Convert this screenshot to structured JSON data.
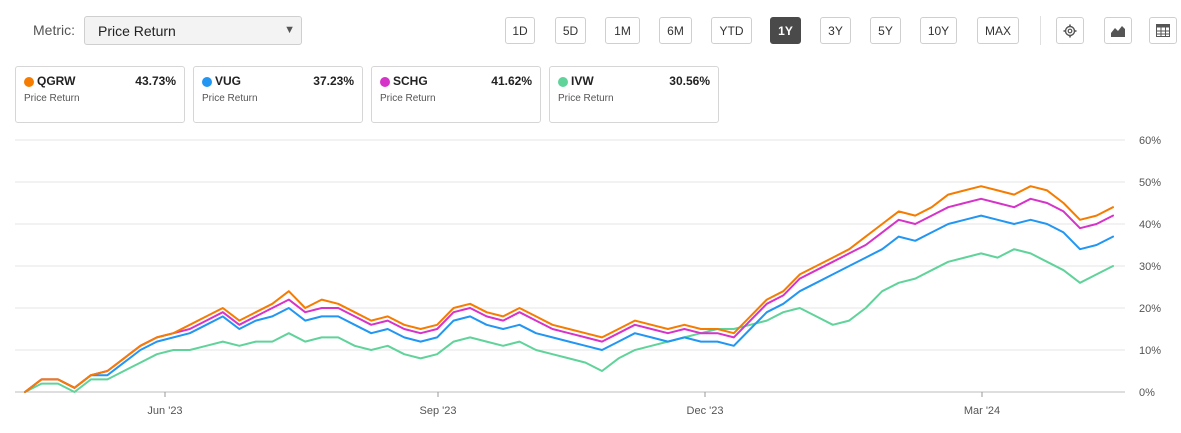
{
  "metric": {
    "label": "Metric:",
    "value": "Price Return"
  },
  "ranges": [
    {
      "label": "1D",
      "active": false
    },
    {
      "label": "5D",
      "active": false
    },
    {
      "label": "1M",
      "active": false
    },
    {
      "label": "6M",
      "active": false
    },
    {
      "label": "YTD",
      "active": false
    },
    {
      "label": "1Y",
      "active": true
    },
    {
      "label": "3Y",
      "active": false
    },
    {
      "label": "5Y",
      "active": false
    },
    {
      "label": "10Y",
      "active": false
    },
    {
      "label": "MAX",
      "active": false
    }
  ],
  "tools": [
    {
      "icon": "gear-icon"
    },
    {
      "icon": "mountain-chart-icon"
    },
    {
      "icon": "table-icon"
    }
  ],
  "cards": [
    {
      "symbol": "QGRW",
      "value": "43.73%",
      "subtitle": "Price Return",
      "color": "#f57c00"
    },
    {
      "symbol": "VUG",
      "value": "37.23%",
      "subtitle": "Price Return",
      "color": "#2196f3"
    },
    {
      "symbol": "SCHG",
      "value": "41.62%",
      "subtitle": "Price Return",
      "color": "#d633c8"
    },
    {
      "symbol": "IVW",
      "value": "30.56%",
      "subtitle": "Price Return",
      "color": "#5fd39a"
    }
  ],
  "chart_data": {
    "type": "line",
    "x_ticks": [
      "Jun '23",
      "Sep '23",
      "Dec '23",
      "Mar '24"
    ],
    "y_ticks": [
      "0%",
      "10%",
      "20%",
      "30%",
      "40%",
      "50%",
      "60%"
    ],
    "ylim": [
      0,
      60
    ],
    "grid": true,
    "series": [
      {
        "name": "QGRW",
        "color": "#f57c00",
        "values": [
          0,
          3,
          3,
          1,
          4,
          5,
          8,
          11,
          13,
          14,
          16,
          18,
          20,
          17,
          19,
          21,
          24,
          20,
          22,
          21,
          19,
          17,
          18,
          16,
          15,
          16,
          20,
          21,
          19,
          18,
          20,
          18,
          16,
          15,
          14,
          13,
          15,
          17,
          16,
          15,
          16,
          15,
          15,
          14,
          18,
          22,
          24,
          28,
          30,
          32,
          34,
          37,
          40,
          43,
          42,
          44,
          47,
          48,
          49,
          48,
          47,
          49,
          48,
          45,
          41,
          42,
          44
        ]
      },
      {
        "name": "VUG",
        "color": "#2196f3",
        "values": [
          0,
          3,
          3,
          1,
          4,
          4,
          7,
          10,
          12,
          13,
          14,
          16,
          18,
          15,
          17,
          18,
          20,
          17,
          18,
          18,
          16,
          14,
          15,
          13,
          12,
          13,
          17,
          18,
          16,
          15,
          16,
          14,
          13,
          12,
          11,
          10,
          12,
          14,
          13,
          12,
          13,
          12,
          12,
          11,
          15,
          19,
          21,
          24,
          26,
          28,
          30,
          32,
          34,
          37,
          36,
          38,
          40,
          41,
          42,
          41,
          40,
          41,
          40,
          38,
          34,
          35,
          37
        ]
      },
      {
        "name": "SCHG",
        "color": "#d633c8",
        "values": [
          0,
          3,
          3,
          1,
          4,
          5,
          8,
          11,
          13,
          14,
          15,
          17,
          19,
          16,
          18,
          20,
          22,
          19,
          20,
          20,
          18,
          16,
          17,
          15,
          14,
          15,
          19,
          20,
          18,
          17,
          19,
          17,
          15,
          14,
          13,
          12,
          14,
          16,
          15,
          14,
          15,
          14,
          14,
          13,
          17,
          21,
          23,
          27,
          29,
          31,
          33,
          35,
          38,
          41,
          40,
          42,
          44,
          45,
          46,
          45,
          44,
          46,
          45,
          43,
          39,
          40,
          42
        ]
      },
      {
        "name": "IVW",
        "color": "#5fd39a",
        "values": [
          0,
          2,
          2,
          0,
          3,
          3,
          5,
          7,
          9,
          10,
          10,
          11,
          12,
          11,
          12,
          12,
          14,
          12,
          13,
          13,
          11,
          10,
          11,
          9,
          8,
          9,
          12,
          13,
          12,
          11,
          12,
          10,
          9,
          8,
          7,
          5,
          8,
          10,
          11,
          12,
          13,
          14,
          15,
          15,
          16,
          17,
          19,
          20,
          18,
          16,
          17,
          20,
          24,
          26,
          27,
          29,
          31,
          32,
          33,
          32,
          34,
          33,
          31,
          29,
          26,
          28,
          30
        ]
      }
    ]
  }
}
